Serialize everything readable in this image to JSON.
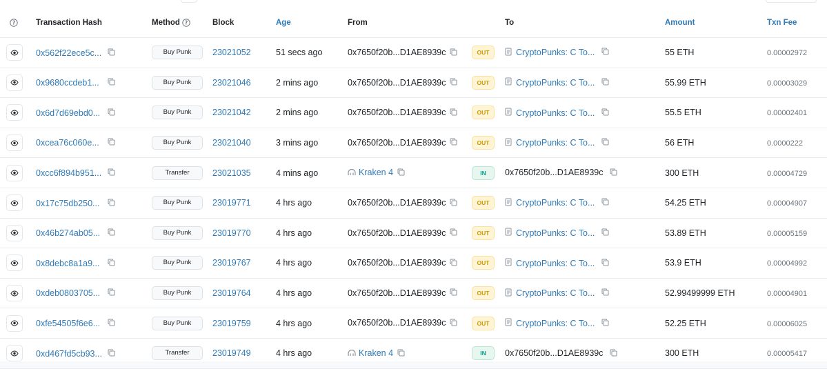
{
  "headers": {
    "hash": "Transaction Hash",
    "method": "Method",
    "block": "Block",
    "age": "Age",
    "from": "From",
    "to": "To",
    "amount": "Amount",
    "fee": "Txn Fee"
  },
  "colors": {
    "link": "#2f7ab7",
    "out_bg": "#fff4d4",
    "out_text": "#cc9a06",
    "in_bg": "#e7f7ef",
    "in_text": "#00a186"
  },
  "rows": [
    {
      "hash": "0x562f22ece5c...",
      "method": "Buy Punk",
      "block": "23021052",
      "age": "51 secs ago",
      "from": "0x7650f20b...D1AE8939c",
      "from_type": "address",
      "dir": "OUT",
      "to": "CryptoPunks: C To...",
      "to_type": "contract",
      "amount": "55 ETH",
      "fee": "0.00002972"
    },
    {
      "hash": "0x9680ccdeb1...",
      "method": "Buy Punk",
      "block": "23021046",
      "age": "2 mins ago",
      "from": "0x7650f20b...D1AE8939c",
      "from_type": "address",
      "dir": "OUT",
      "to": "CryptoPunks: C To...",
      "to_type": "contract",
      "amount": "55.99 ETH",
      "fee": "0.00003029"
    },
    {
      "hash": "0x6d7d69ebd0...",
      "method": "Buy Punk",
      "block": "23021042",
      "age": "2 mins ago",
      "from": "0x7650f20b...D1AE8939c",
      "from_type": "address",
      "dir": "OUT",
      "to": "CryptoPunks: C To...",
      "to_type": "contract",
      "amount": "55.5 ETH",
      "fee": "0.00002401"
    },
    {
      "hash": "0xcea76c060e...",
      "method": "Buy Punk",
      "block": "23021040",
      "age": "3 mins ago",
      "from": "0x7650f20b...D1AE8939c",
      "from_type": "address",
      "dir": "OUT",
      "to": "CryptoPunks: C To...",
      "to_type": "contract",
      "amount": "56 ETH",
      "fee": "0.0000222"
    },
    {
      "hash": "0xcc6f894b951...",
      "method": "Transfer",
      "block": "23021035",
      "age": "4 mins ago",
      "from": "Kraken 4",
      "from_type": "exchange",
      "dir": "IN",
      "to": "0x7650f20b...D1AE8939c",
      "to_type": "address",
      "amount": "300 ETH",
      "fee": "0.00004729"
    },
    {
      "hash": "0x17c75db250...",
      "method": "Buy Punk",
      "block": "23019771",
      "age": "4 hrs ago",
      "from": "0x7650f20b...D1AE8939c",
      "from_type": "address",
      "dir": "OUT",
      "to": "CryptoPunks: C To...",
      "to_type": "contract",
      "amount": "54.25 ETH",
      "fee": "0.00004907"
    },
    {
      "hash": "0x46b274ab05...",
      "method": "Buy Punk",
      "block": "23019770",
      "age": "4 hrs ago",
      "from": "0x7650f20b...D1AE8939c",
      "from_type": "address",
      "dir": "OUT",
      "to": "CryptoPunks: C To...",
      "to_type": "contract",
      "amount": "53.89 ETH",
      "fee": "0.00005159"
    },
    {
      "hash": "0x8debc8a1a9...",
      "method": "Buy Punk",
      "block": "23019767",
      "age": "4 hrs ago",
      "from": "0x7650f20b...D1AE8939c",
      "from_type": "address",
      "dir": "OUT",
      "to": "CryptoPunks: C To...",
      "to_type": "contract",
      "amount": "53.9 ETH",
      "fee": "0.00004992"
    },
    {
      "hash": "0xdeb0803705...",
      "method": "Buy Punk",
      "block": "23019764",
      "age": "4 hrs ago",
      "from": "0x7650f20b...D1AE8939c",
      "from_type": "address",
      "dir": "OUT",
      "to": "CryptoPunks: C To...",
      "to_type": "contract",
      "amount": "52.99499999 ETH",
      "fee": "0.00004901"
    },
    {
      "hash": "0xfe54505f6e6...",
      "method": "Buy Punk",
      "block": "23019759",
      "age": "4 hrs ago",
      "from": "0x7650f20b...D1AE8939c",
      "from_type": "address",
      "dir": "OUT",
      "to": "CryptoPunks: C To...",
      "to_type": "contract",
      "amount": "52.25 ETH",
      "fee": "0.00006025"
    },
    {
      "hash": "0xd467fd5cb93...",
      "method": "Transfer",
      "block": "23019749",
      "age": "4 hrs ago",
      "from": "Kraken 4",
      "from_type": "exchange",
      "dir": "IN",
      "to": "0x7650f20b...D1AE8939c",
      "to_type": "address",
      "amount": "300 ETH",
      "fee": "0.00005417"
    }
  ]
}
